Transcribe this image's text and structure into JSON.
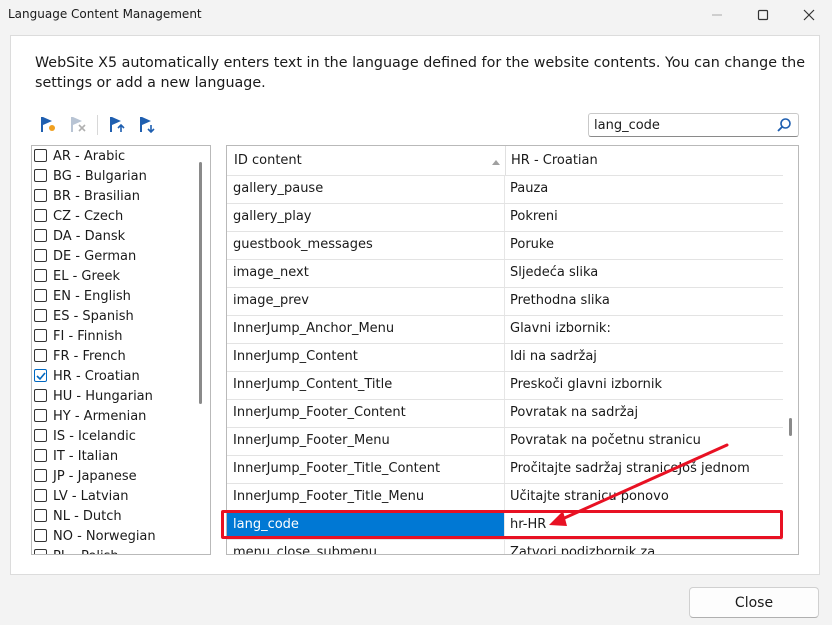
{
  "window": {
    "title": "Language Content Management",
    "icons": {
      "minimize": "minimize-icon",
      "maximize": "maximize-icon",
      "close": "close-icon"
    }
  },
  "description": "WebSite X5 automatically enters text in the language defined for the website contents. You can change the settings or add a new language.",
  "toolbar": {
    "icons": [
      "add-language-flag-icon",
      "remove-language-flag-icon",
      "move-up-flag-icon",
      "move-down-flag-icon"
    ]
  },
  "search": {
    "value": "lang_code",
    "icon": "search-icon"
  },
  "languages": [
    {
      "label": "AR - Arabic",
      "checked": false
    },
    {
      "label": "BG - Bulgarian",
      "checked": false
    },
    {
      "label": "BR - Brasilian",
      "checked": false
    },
    {
      "label": "CZ - Czech",
      "checked": false
    },
    {
      "label": "DA - Dansk",
      "checked": false
    },
    {
      "label": "DE - German",
      "checked": false
    },
    {
      "label": "EL - Greek",
      "checked": false
    },
    {
      "label": "EN - English",
      "checked": false
    },
    {
      "label": "ES - Spanish",
      "checked": false
    },
    {
      "label": "FI - Finnish",
      "checked": false
    },
    {
      "label": "FR - French",
      "checked": false
    },
    {
      "label": "HR - Croatian",
      "checked": true
    },
    {
      "label": "HU - Hungarian",
      "checked": false
    },
    {
      "label": "HY - Armenian",
      "checked": false
    },
    {
      "label": "IS - Icelandic",
      "checked": false
    },
    {
      "label": "IT - Italian",
      "checked": false
    },
    {
      "label": "JP - Japanese",
      "checked": false
    },
    {
      "label": "LV - Latvian",
      "checked": false
    },
    {
      "label": "NL - Dutch",
      "checked": false
    },
    {
      "label": "NO - Norwegian",
      "checked": false
    },
    {
      "label": "PL - Polish",
      "checked": false
    }
  ],
  "table": {
    "headers": [
      "ID content",
      "HR - Croatian"
    ],
    "rows": [
      {
        "id": "gallery_pause",
        "value": "Pauza",
        "selected": false
      },
      {
        "id": "gallery_play",
        "value": "Pokreni",
        "selected": false
      },
      {
        "id": "guestbook_messages",
        "value": "Poruke",
        "selected": false
      },
      {
        "id": "image_next",
        "value": "Sljedeća slika",
        "selected": false
      },
      {
        "id": "image_prev",
        "value": "Prethodna slika",
        "selected": false
      },
      {
        "id": "InnerJump_Anchor_Menu",
        "value": "Glavni izbornik:",
        "selected": false
      },
      {
        "id": "InnerJump_Content",
        "value": "Idi na sadržaj",
        "selected": false
      },
      {
        "id": "InnerJump_Content_Title",
        "value": "Preskoči glavni izbornik",
        "selected": false
      },
      {
        "id": "InnerJump_Footer_Content",
        "value": "Povratak na sadržaj",
        "selected": false
      },
      {
        "id": "InnerJump_Footer_Menu",
        "value": "Povratak na početnu stranicu",
        "selected": false
      },
      {
        "id": "InnerJump_Footer_Title_Content",
        "value": "Pročitajte sadržaj straniceJoš jednom",
        "selected": false
      },
      {
        "id": "InnerJump_Footer_Title_Menu",
        "value": "Učitajte stranicu ponovo",
        "selected": false
      },
      {
        "id": "lang_code",
        "value": "hr-HR",
        "selected": true
      },
      {
        "id": "menu_close_submenu",
        "value": "Zatvori podizbornik za",
        "selected": false
      }
    ]
  },
  "annotation": {
    "color": "#e81123"
  },
  "buttons": {
    "close": "Close"
  }
}
